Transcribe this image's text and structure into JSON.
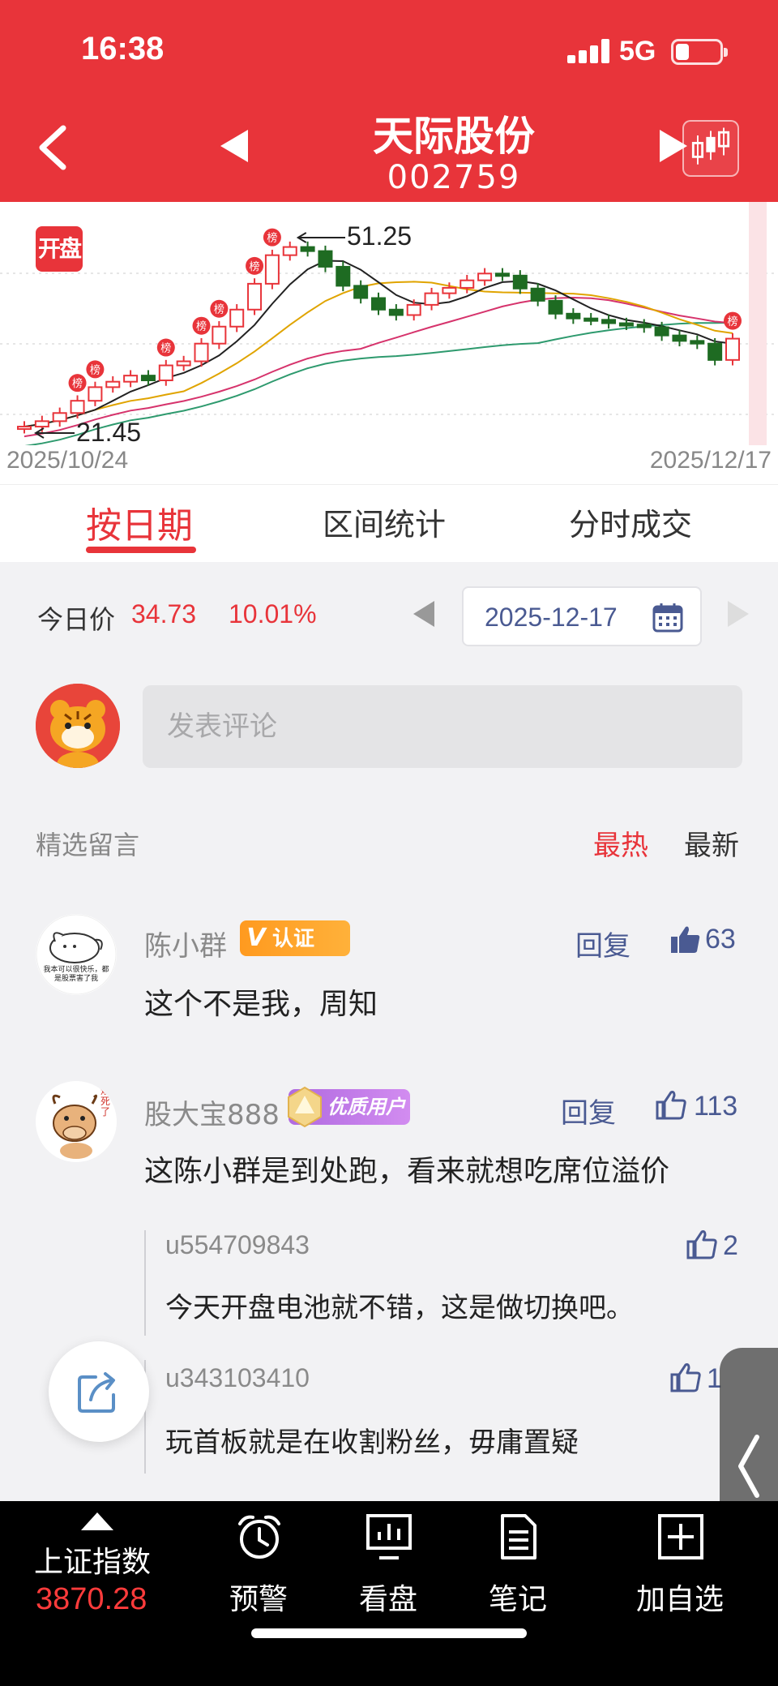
{
  "status_bar": {
    "time": "16:38",
    "network": "5G"
  },
  "header": {
    "stock_name": "天际股份",
    "stock_code": "002759"
  },
  "chart": {
    "badge": "开盘",
    "date_start": "2025/10/24",
    "date_end": "2025/12/17",
    "high_label": "51.25",
    "low_label": "21.45",
    "bang_label": "榜",
    "colors": {
      "up": "#e8343a",
      "down": "#1e6b22",
      "ma5": "#222222",
      "ma10": "#e0a400",
      "ma20": "#d6336c",
      "ma30": "#2e9a6e"
    }
  },
  "chart_data": {
    "type": "candlestick",
    "x_start": "2025/10/24",
    "x_end": "2025/12/17",
    "high": 51.25,
    "low": 21.45,
    "close": [
      21.8,
      22.6,
      23.8,
      25.6,
      27.6,
      28.4,
      29.3,
      28.6,
      30.8,
      31.4,
      34.0,
      36.5,
      39.0,
      42.8,
      47.0,
      48.2,
      47.6,
      45.3,
      42.5,
      40.7,
      39.0,
      38.2,
      39.7,
      41.4,
      42.2,
      43.3,
      44.3,
      44.0,
      42.1,
      40.3,
      38.4,
      37.7,
      37.5,
      37.0,
      36.8,
      36.4,
      35.2,
      34.4,
      34.0,
      31.6,
      34.73
    ]
  },
  "tabs": [
    {
      "label": "按日期"
    },
    {
      "label": "区间统计"
    },
    {
      "label": "分时成交"
    }
  ],
  "price_row": {
    "label": "今日价",
    "price": "34.73",
    "change": "10.01%",
    "date": "2025-12-17"
  },
  "comment_box": {
    "placeholder": "发表评论"
  },
  "comments_header": {
    "title": "精选留言",
    "sort_hot": "最热",
    "sort_new": "最新"
  },
  "comments": [
    {
      "user": "陈小群",
      "badge": "认证",
      "badge_v": "V",
      "avatar_text": "我本可以很快乐，都是股票害了我",
      "reply": "回复",
      "likes": "63",
      "text": "这个不是我，周知"
    },
    {
      "user": "股大宝888",
      "badge": "优质用户",
      "avatar_text": "烦死了",
      "reply": "回复",
      "likes": "113",
      "text": "这陈小群是到处跑，看来就想吃席位溢价",
      "replies": [
        {
          "user": "u554709843",
          "likes": "2",
          "text": "今天开盘电池就不错，这是做切换吧。"
        },
        {
          "user": "u343103410",
          "likes": "1",
          "text": "玩首板就是在收割粉丝，毋庸置疑"
        }
      ]
    }
  ],
  "bottom_nav": {
    "index_name": "上证指数",
    "index_value": "3870.28",
    "items": [
      {
        "label": "预警"
      },
      {
        "label": "看盘"
      },
      {
        "label": "笔记"
      },
      {
        "label": "加自选"
      }
    ]
  }
}
